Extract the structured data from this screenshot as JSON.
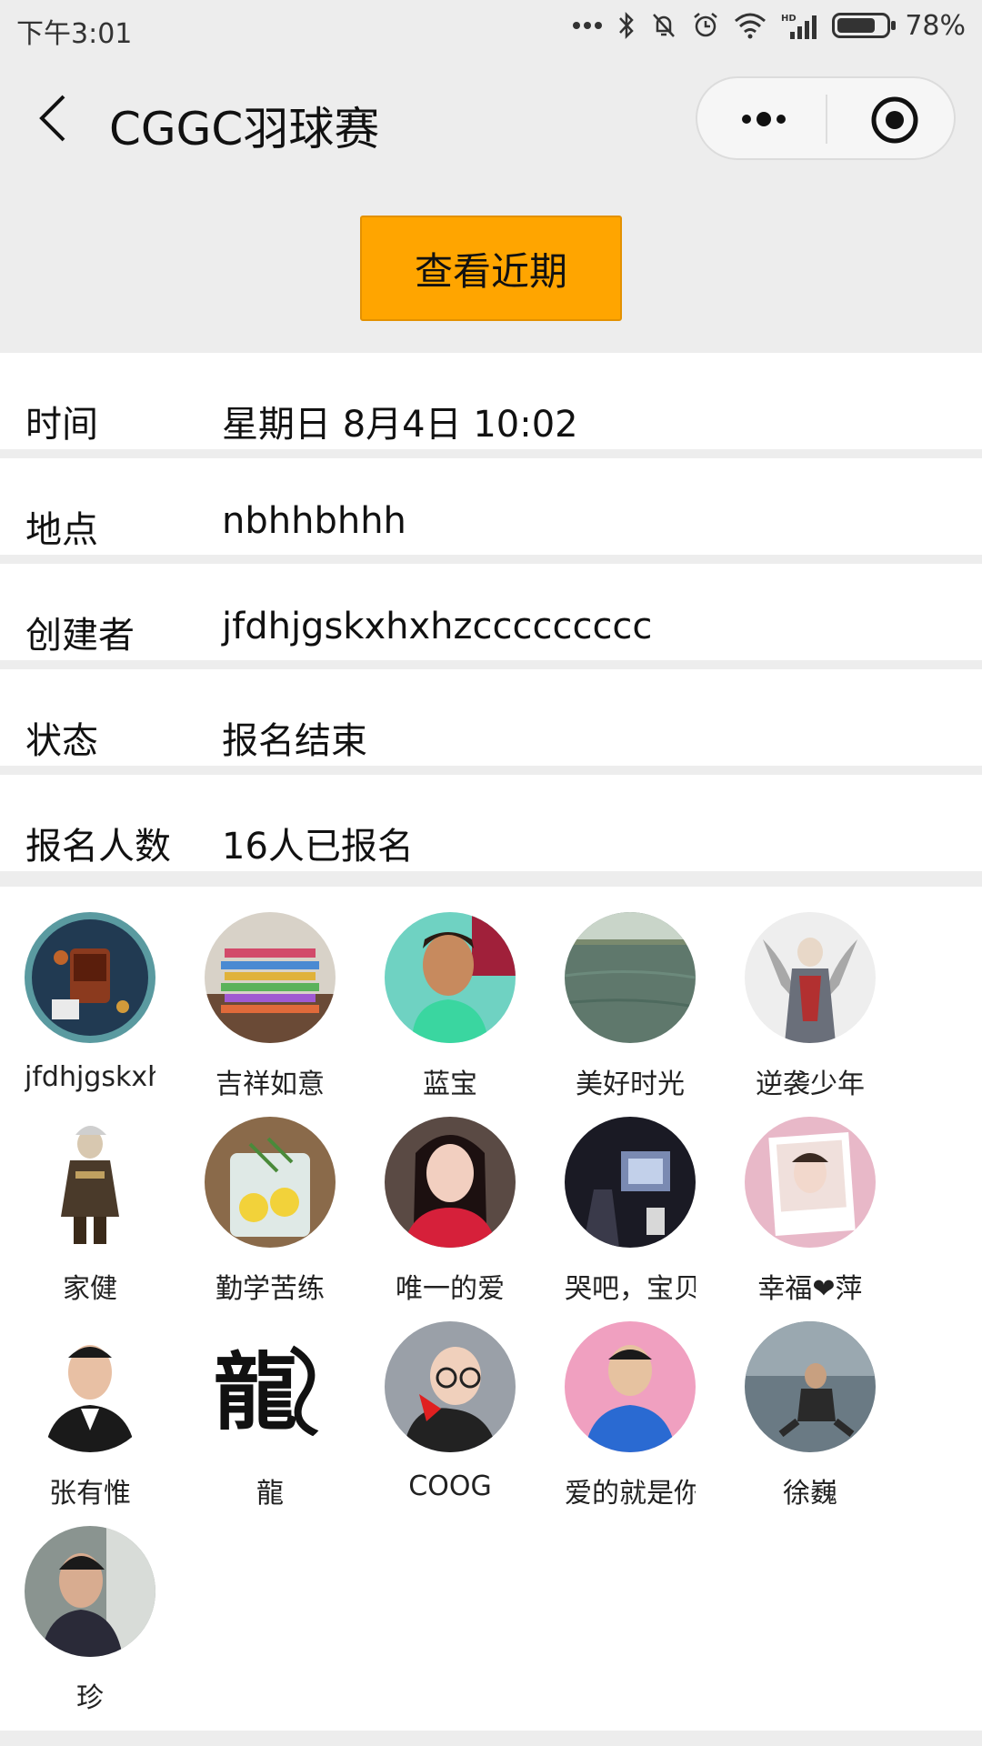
{
  "status_bar": {
    "time": "下午3:01",
    "battery_percent": "78%",
    "battery_level": 0.78,
    "icons": [
      "dots-icon",
      "bluetooth-icon",
      "mute-bell-icon",
      "alarm-icon",
      "wifi-icon",
      "hd-signal-icon",
      "battery-icon"
    ]
  },
  "navbar": {
    "title": "CGGC羽球赛"
  },
  "recent_button": {
    "label": "查看近期",
    "color": "#ffa500"
  },
  "info": [
    {
      "label": "时间",
      "value": "星期日 8月4日 10:02"
    },
    {
      "label": "地点",
      "value": "nbhhbhhh"
    },
    {
      "label": "创建者",
      "value": "jfdhjgskxhxhzccccccccc"
    },
    {
      "label": "状态",
      "value": "报名结束"
    },
    {
      "label": "报名人数",
      "value": "16人已报名"
    }
  ],
  "participants": [
    {
      "name": "jfdhjgskxhxhzccccccccc",
      "avatar": "teacup-photo"
    },
    {
      "name": "吉祥如意",
      "avatar": "colorful-stack-photo"
    },
    {
      "name": "蓝宝",
      "avatar": "soccer-player-photo"
    },
    {
      "name": "美好时光",
      "avatar": "lake-photo"
    },
    {
      "name": "逆袭少年",
      "avatar": "anime-warrior-photo"
    },
    {
      "name": "家健",
      "avatar": "game-character-photo"
    },
    {
      "name": "勤学苦练",
      "avatar": "lemon-drink-photo"
    },
    {
      "name": "唯一的爱",
      "avatar": "woman-red-photo"
    },
    {
      "name": "哭吧，宝贝",
      "avatar": "dark-room-photo"
    },
    {
      "name": "幸福❤萍",
      "avatar": "polaroid-girl-photo"
    },
    {
      "name": "张有惟",
      "avatar": "man-portrait-photo"
    },
    {
      "name": "龍",
      "avatar": "dragon-calligraphy"
    },
    {
      "name": "COOG",
      "avatar": "boy-glasses-photo"
    },
    {
      "name": "爱的就是你",
      "avatar": "young-man-photo"
    },
    {
      "name": "徐巍",
      "avatar": "sitting-man-photo"
    },
    {
      "name": "珍",
      "avatar": "woman-photo"
    }
  ]
}
